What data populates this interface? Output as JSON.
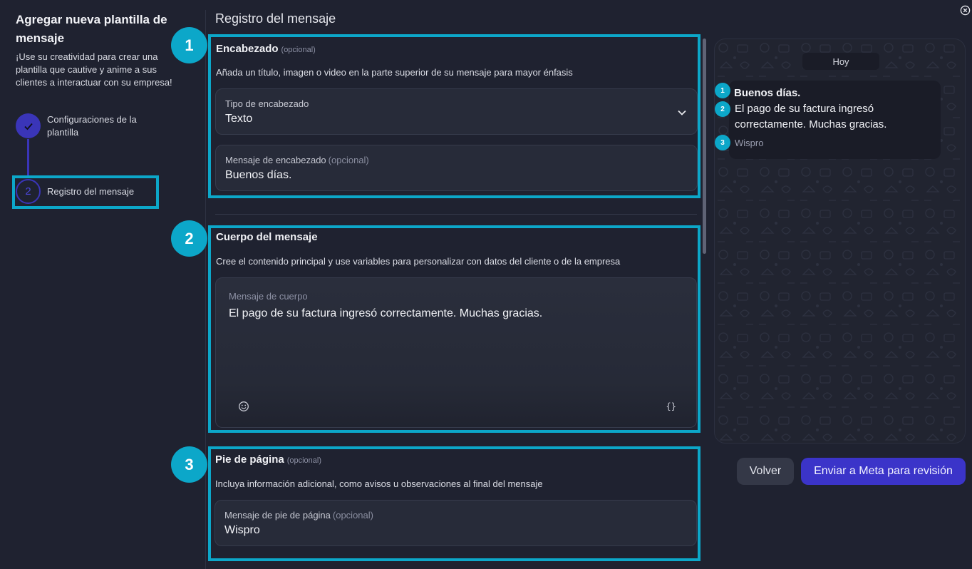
{
  "left": {
    "title": "Agregar nueva plantilla de mensaje",
    "description": "¡Use su creatividad para crear una plantilla que cautive y anime a sus clientes a interactuar con su empresa!",
    "steps": [
      {
        "number": "1",
        "label": "Configuraciones de la plantilla",
        "status": "done",
        "icon": "check-icon"
      },
      {
        "number": "2",
        "label": "Registro del mensaje",
        "status": "active"
      }
    ]
  },
  "main": {
    "title": "Registro del mensaje",
    "header": {
      "badge": "1",
      "title": "Encabezado",
      "optional": "(opcional)",
      "description": "Añada un título, imagen o video en la parte superior de su mensaje para mayor énfasis",
      "type_label": "Tipo de encabezado",
      "type_value": "Texto",
      "message_label": "Mensaje de encabezado",
      "message_optional": "(opcional)",
      "message_value": "Buenos días."
    },
    "body": {
      "badge": "2",
      "title": "Cuerpo del mensaje",
      "description": "Cree el contenido principal y use variables para personalizar con datos del cliente o de la empresa",
      "label": "Mensaje de cuerpo",
      "value": "El pago de su factura ingresó correctamente. Muchas gracias.",
      "variables_icon": "{}"
    },
    "footer": {
      "badge": "3",
      "title": "Pie de página",
      "optional": "(opcional)",
      "description": "Incluya información adicional, como avisos u observaciones al final del mensaje",
      "label": "Mensaje de pie de página",
      "label_optional": "(opcional)",
      "value": "Wispro"
    }
  },
  "preview": {
    "date_pill": "Hoy",
    "header_badge": "1",
    "header_text": "Buenos días.",
    "body_badge": "2",
    "body_line1": "El pago de su factura ingresó",
    "body_line2": "correctamente. Muchas gracias.",
    "footer_badge": "3",
    "footer_text": "Wispro"
  },
  "actions": {
    "back": "Volver",
    "submit": "Enviar a Meta para revisión"
  },
  "colors": {
    "background": "#1f2230",
    "accent": "#3b34c9",
    "highlight": "#0ca7c9"
  }
}
